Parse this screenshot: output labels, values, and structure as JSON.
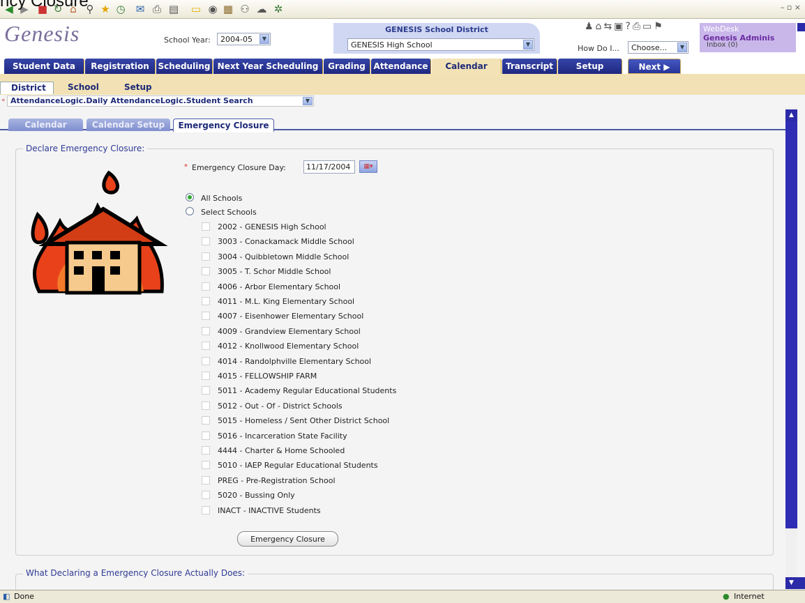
{
  "top_title": "ncy Closure",
  "app": {
    "logo": "Genesis",
    "school_year_label": "School Year:",
    "school_year_value": "2004-05",
    "district_name": "GENESIS School District",
    "school_value": "GENESIS High School",
    "how_do_label": "How Do I...",
    "how_do_value": "Choose...",
    "user_name": "WebDesk",
    "user_role": "Genesis Adminis",
    "inbox": "Inbox (0)"
  },
  "main_tabs": [
    {
      "label": "Student Data"
    },
    {
      "label": "Registration"
    },
    {
      "label": "Scheduling"
    },
    {
      "label": "Next Year Scheduling"
    },
    {
      "label": "Grading"
    },
    {
      "label": "Attendance"
    },
    {
      "label": "Calendar"
    },
    {
      "label": "Transcript"
    },
    {
      "label": "Setup"
    },
    {
      "label": "Next ▶"
    }
  ],
  "sub_tabs": [
    "District",
    "School",
    "Setup"
  ],
  "path_select": "AttendanceLogic.Daily AttendanceLogic.Student Search",
  "page_tabs": [
    "Calendar",
    "Calendar Setup",
    "Emergency Closure"
  ],
  "form": {
    "legend": "Declare Emergency Closure:",
    "closure_day_label": "Emergency Closure Day:",
    "closure_day_value": "11/17/2004",
    "radio_all": "All Schools",
    "radio_select": "Select Schools",
    "schools": [
      "2002 - GENESIS High School",
      "3003 - Conackamack Middle School",
      "3004 - Quibbletown Middle School",
      "3005 - T. Schor Middle School",
      "4006 - Arbor Elementary School",
      "4011 - M.L. King Elementary School",
      "4007 - Eisenhower Elementary School",
      "4009 - Grandview Elementary School",
      "4012 - Knollwood Elementary School",
      "4014 - Randolphville Elementary School",
      "4015 - FELLOWSHIP FARM",
      "5011 - Academy Regular Educational Students",
      "5012 - Out - Of - District Schools",
      "5015 - Homeless / Sent Other District School",
      "5016 - Incarceration State Facility",
      "4444 - Charter & Home Schooled",
      "5010 - IAEP Regular Educational Students",
      "PREG - Pre-Registration School",
      "5020 - Bussing Only",
      "INACT - INACTIVE Students"
    ],
    "submit_label": "Emergency Closure"
  },
  "info_legend": "What Declaring a Emergency Closure Actually Does:",
  "status": {
    "left": "Done",
    "zone": "Internet"
  },
  "colors": {
    "nav_blue": "#1e2880",
    "calendar_tab": "#f3e2b5",
    "scroll_blue": "#2f2db4",
    "flame": "#e9421a"
  }
}
